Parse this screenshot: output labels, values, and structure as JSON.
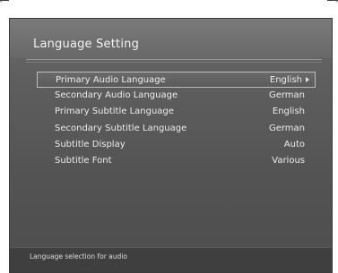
{
  "title": "Language Setting",
  "menu": [
    {
      "label": "Primary Audio Language",
      "value": "English"
    },
    {
      "label": "Secondary Audio Language",
      "value": "German"
    },
    {
      "label": "Primary Subtitle Language",
      "value": "English"
    },
    {
      "label": "Secondary Subtitle Language",
      "value": "German"
    },
    {
      "label": "Subtitle Display",
      "value": "Auto"
    },
    {
      "label": "Subtitle Font",
      "value": "Various"
    }
  ],
  "selected_index": 0,
  "help_text": "Language selection for audio",
  "colors": {
    "background": "#555555",
    "header": "#707070",
    "text": "#ececec",
    "selection_border": "#bdbdbd"
  },
  "icons": {
    "selected_arrow": "right-triangle-icon"
  }
}
